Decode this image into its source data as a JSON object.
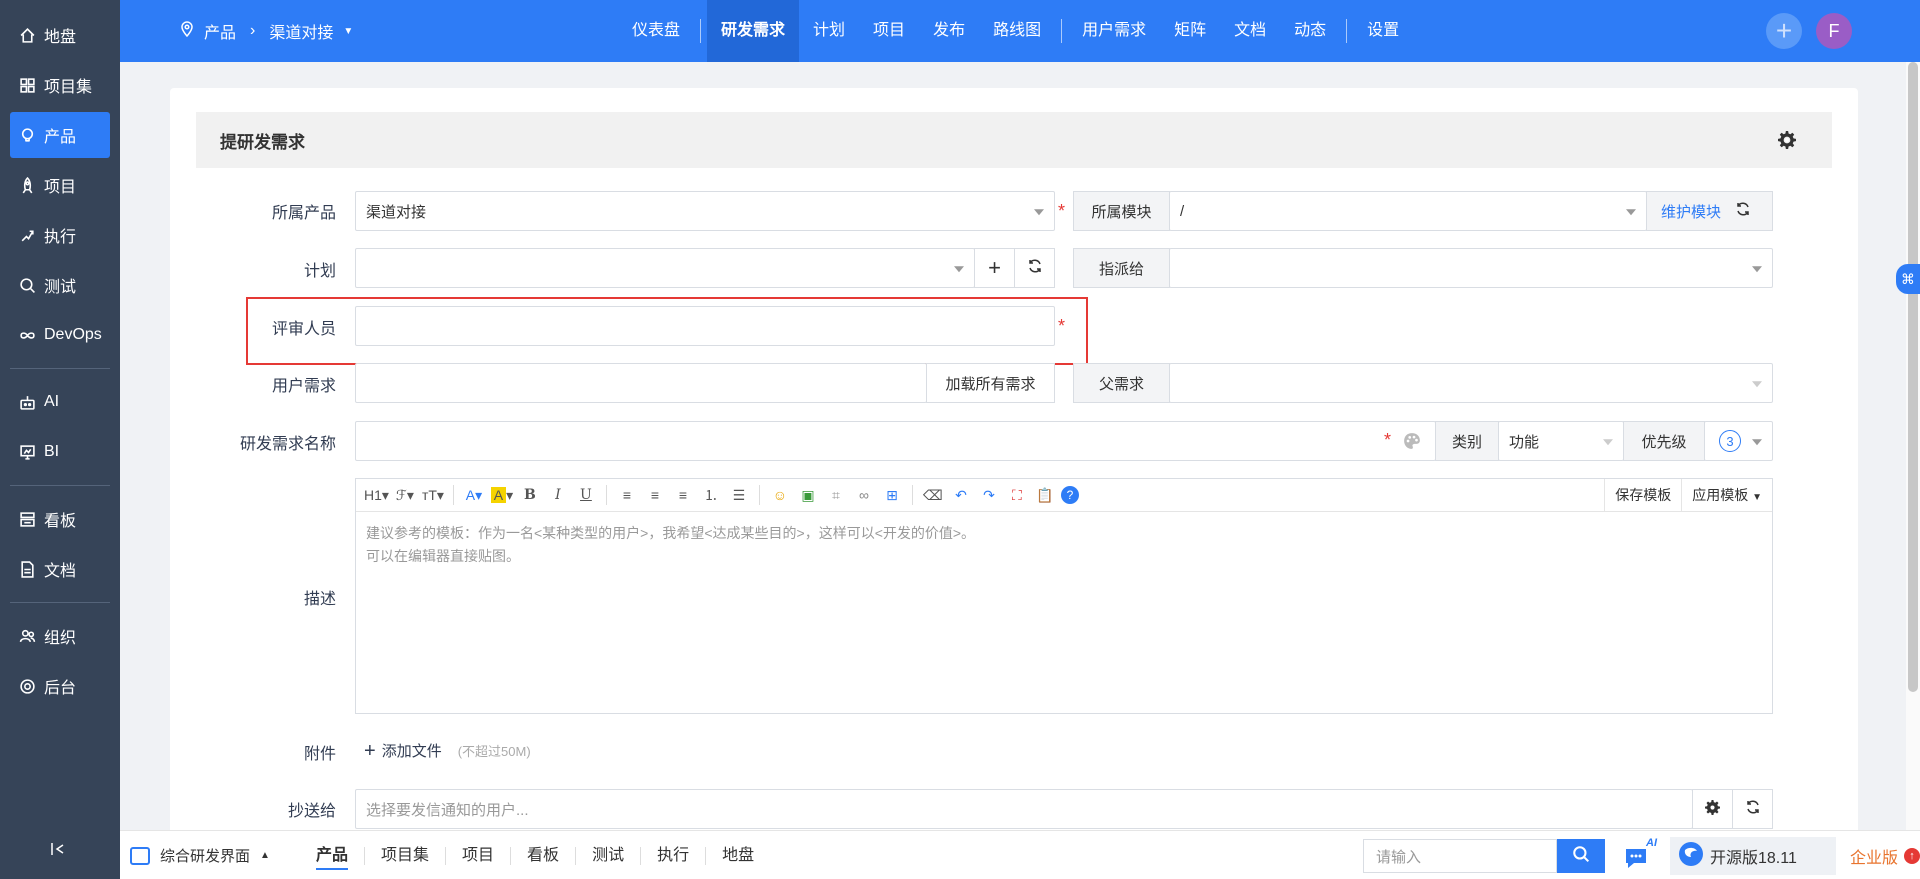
{
  "sidebar": {
    "items": [
      {
        "label": "地盘",
        "icon": "home-icon"
      },
      {
        "label": "项目集",
        "icon": "grid-icon"
      },
      {
        "label": "产品",
        "icon": "lightbulb-icon",
        "active": true
      },
      {
        "label": "项目",
        "icon": "rocket-icon"
      },
      {
        "label": "执行",
        "icon": "run-icon"
      },
      {
        "label": "测试",
        "icon": "search-icon"
      },
      {
        "label": "DevOps",
        "icon": "infinity-icon"
      },
      {
        "label": "AI",
        "icon": "robot-icon"
      },
      {
        "label": "BI",
        "icon": "chart-board-icon"
      },
      {
        "label": "看板",
        "icon": "kanban-icon"
      },
      {
        "label": "文档",
        "icon": "document-icon"
      },
      {
        "label": "组织",
        "icon": "people-icon"
      },
      {
        "label": "后台",
        "icon": "gear-icon"
      }
    ]
  },
  "header": {
    "breadcrumb": {
      "root": "产品",
      "current": "渠道对接"
    },
    "nav": [
      "仪表盘",
      "研发需求",
      "计划",
      "项目",
      "发布",
      "路线图",
      "用户需求",
      "矩阵",
      "文档",
      "动态",
      "设置"
    ],
    "active_nav": "研发需求",
    "avatar_letter": "F",
    "accent_color": "#2e7cf6"
  },
  "form": {
    "title": "提研发需求",
    "product": {
      "label": "所属产品",
      "value": "渠道对接"
    },
    "module": {
      "label": "所属模块",
      "value": "/",
      "maintain": "维护模块"
    },
    "plan": {
      "label": "计划",
      "value": ""
    },
    "assign": {
      "label": "指派给",
      "value": ""
    },
    "reviewer": {
      "label": "评审人员",
      "value": ""
    },
    "user_story": {
      "label": "用户需求",
      "value": "",
      "load_all": "加载所有需求"
    },
    "parent": {
      "label": "父需求",
      "value": ""
    },
    "name": {
      "label": "研发需求名称",
      "value": ""
    },
    "category": {
      "label": "类别",
      "value": "功能"
    },
    "priority": {
      "label": "优先级",
      "value": "3"
    },
    "description": {
      "label": "描述",
      "placeholder_line1": "建议参考的模板：作为一名<某种类型的用户>，我希望<达成某些目的>，这样可以<开发的价值>。",
      "placeholder_line2": "可以在编辑器直接贴图。",
      "save_template": "保存模板",
      "apply_template": "应用模板"
    },
    "attachment": {
      "label": "附件",
      "add": "添加文件",
      "limit": "(不超过50M)"
    },
    "cc": {
      "label": "抄送给",
      "placeholder": "选择要发信通知的用户..."
    }
  },
  "bottombar": {
    "app": "综合研发界面",
    "tabs": [
      "产品",
      "项目集",
      "项目",
      "看板",
      "测试",
      "执行",
      "地盘"
    ],
    "active_tab": "产品",
    "search_placeholder": "请输入",
    "version": "开源版18.11",
    "enterprise": "企业版",
    "ai_badge": "AI"
  }
}
